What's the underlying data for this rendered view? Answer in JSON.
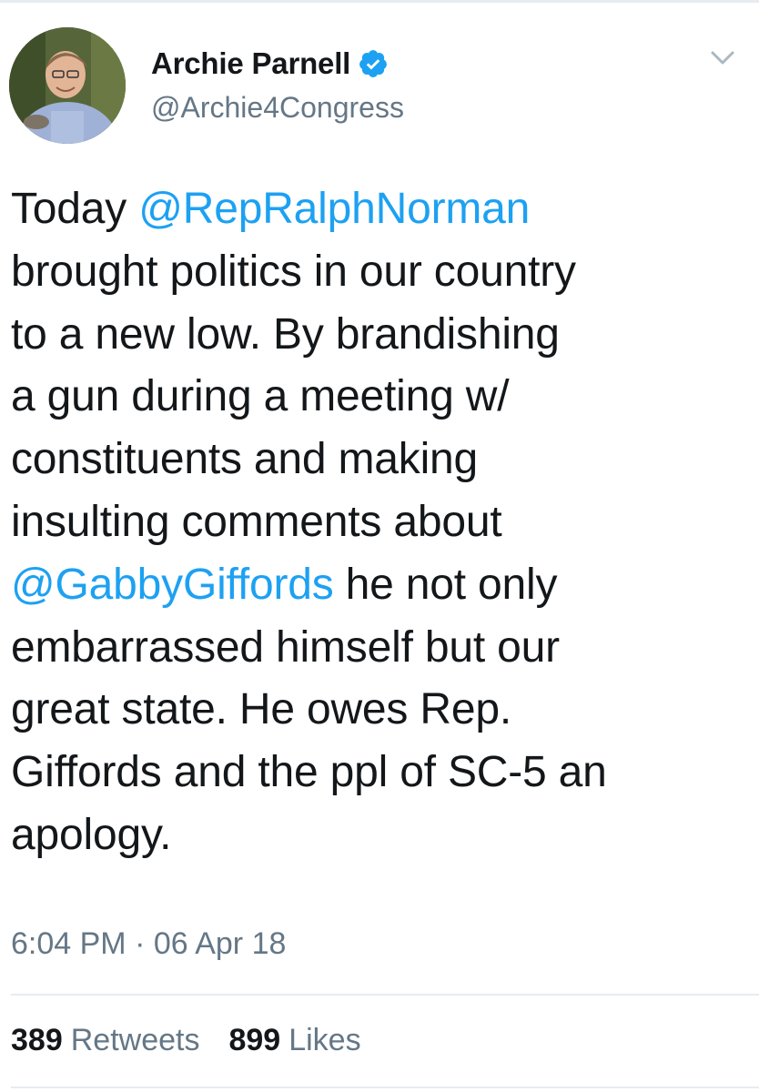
{
  "colors": {
    "text": "#14171a",
    "secondary": "#657786",
    "link": "#1da1f2",
    "verified": "#1da1f2",
    "divider": "#e6ecf0"
  },
  "author": {
    "name": "Archie Parnell",
    "handle": "@Archie4Congress",
    "verified_icon": "verified-badge-icon",
    "avatar_icon": "profile-photo"
  },
  "menu_icon": "chevron-down-icon",
  "tweet": {
    "lines": [
      {
        "parts": [
          {
            "text": "Today "
          },
          {
            "text": "@RepRalphNorman",
            "mention": true
          }
        ]
      },
      {
        "parts": [
          {
            "text": "brought politics in our country"
          }
        ]
      },
      {
        "parts": [
          {
            "text": "to a new low. By brandishing"
          }
        ]
      },
      {
        "parts": [
          {
            "text": "a gun during a meeting w/"
          }
        ]
      },
      {
        "parts": [
          {
            "text": "constituents and making"
          }
        ]
      },
      {
        "parts": [
          {
            "text": "insulting comments about"
          }
        ]
      },
      {
        "parts": [
          {
            "text": "@GabbyGiffords",
            "mention": true
          },
          {
            "text": " he not only"
          }
        ]
      },
      {
        "parts": [
          {
            "text": "embarrassed himself but our"
          }
        ]
      },
      {
        "parts": [
          {
            "text": "great state. He owes Rep."
          }
        ]
      },
      {
        "parts": [
          {
            "text": "Giffords and the ppl of SC-5 an"
          }
        ]
      },
      {
        "parts": [
          {
            "text": "apology."
          }
        ]
      }
    ],
    "timestamp": "6:04 PM · 06 Apr 18"
  },
  "stats": {
    "retweets_count": "389",
    "retweets_label": "Retweets",
    "likes_count": "899",
    "likes_label": "Likes"
  }
}
